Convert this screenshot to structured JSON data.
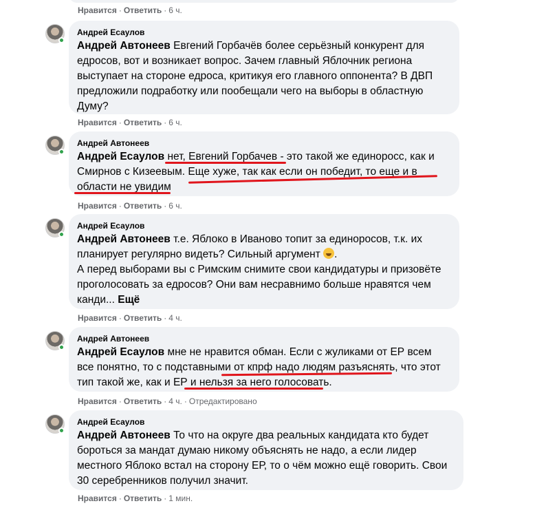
{
  "comments": [
    {
      "author": "",
      "mention": "",
      "text": "",
      "more": "",
      "actions": {
        "like": "Нравится",
        "reply": "Ответить",
        "time": "6 ч.",
        "edited": ""
      }
    },
    {
      "author": "Андрей Есаулов",
      "mention": "Андрей Автонеев",
      "text": "Евгений Горбачёв более серьёзный конкурент для едросов, вот и возникает вопрос. Зачем главный Яблочник региона выступает на стороне едроса, критикуя его главного оппонента? В ДВП предложили подработку или пообещали чего на выборы в областную Думу?",
      "actions": {
        "like": "Нравится",
        "reply": "Ответить",
        "time": "6 ч."
      }
    },
    {
      "author": "Андрей Автонеев",
      "mention": "Андрей Есаулов",
      "text": "нет, Евгений Горбачев - это такой же единоросс, как и Смирнов с Кизеевым. Еще хуже, так как если он победит, то еще и в области не увидим",
      "actions": {
        "like": "Нравится",
        "reply": "Ответить",
        "time": "6 ч."
      }
    },
    {
      "author": "Андрей Есаулов",
      "mention": "Андрей Автонеев",
      "text": "т.е. Яблоко в Иваново топит за единоросов, т.к. их планирует регулярно видеть? Сильный аргумент",
      "emoji": "rofl-emoji",
      "text2": "А перед выборами вы с Римским снимите свои кандидатуры и призовёте проголосовать за едросов? Они вам несравнимо больше нравятся чем канди...",
      "more": "Ещё",
      "actions": {
        "like": "Нравится",
        "reply": "Ответить",
        "time": "4 ч."
      }
    },
    {
      "author": "Андрей Автонеев",
      "mention": "Андрей Есаулов",
      "text": "мне не нравится обман. Если с жуликами от ЕР всем все понятно, то с подставными от кпрф надо людям разъяснять, что этот тип такой же, как и ЕР и нельзя за него голосовать.",
      "actions": {
        "like": "Нравится",
        "reply": "Ответить",
        "time": "4 ч.",
        "edited": "Отредактировано"
      }
    },
    {
      "author": "Андрей Есаулов",
      "mention": "Андрей Автонеев",
      "text": "То что на округе два реальных кандидата кто будет бороться за мандат думаю никому объяснять не надо, а если лидер местного Яблоко встал на сторону ЕР, то о чём можно ещё говорить. Свои 30 серебренников получил значит.",
      "actions": {
        "like": "Нравится",
        "reply": "Ответить",
        "time": "1 мин."
      }
    }
  ],
  "colors": {
    "bubble": "#f0f2f5",
    "meta": "#65676b",
    "online": "#31a24c",
    "annotation": "#e0151c"
  }
}
